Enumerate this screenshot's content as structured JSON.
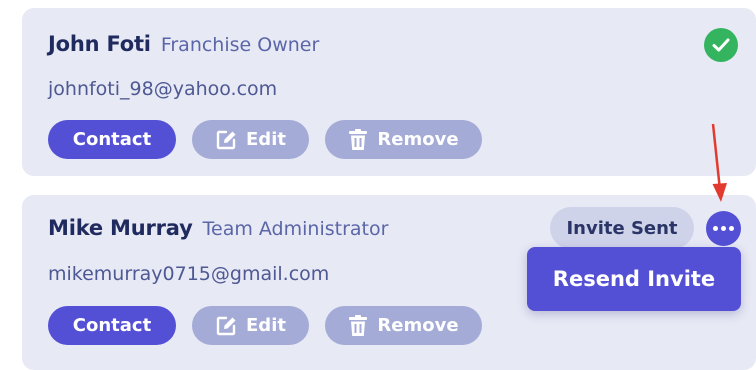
{
  "members": [
    {
      "name": "John Foti",
      "role": "Franchise Owner",
      "email": "johnfoti_98@yahoo.com",
      "status_icon": "check-circle-icon",
      "status_color": "#35b45f",
      "buttons": {
        "contact": "Contact",
        "edit": "Edit",
        "remove": "Remove"
      }
    },
    {
      "name": "Mike Murray",
      "role": "Team Administrator",
      "email": "mikemurray0715@gmail.com",
      "status_badge": "Invite Sent",
      "more_icon": "more-dots-icon",
      "buttons": {
        "contact": "Contact",
        "edit": "Edit",
        "remove": "Remove"
      }
    }
  ],
  "dropdown": {
    "items": [
      "Resend Invite"
    ]
  },
  "colors": {
    "accent": "#5450d6",
    "card_bg": "#e7e9f5",
    "muted_button": "#a4abd6",
    "annotation_arrow": "#e23a2e"
  }
}
